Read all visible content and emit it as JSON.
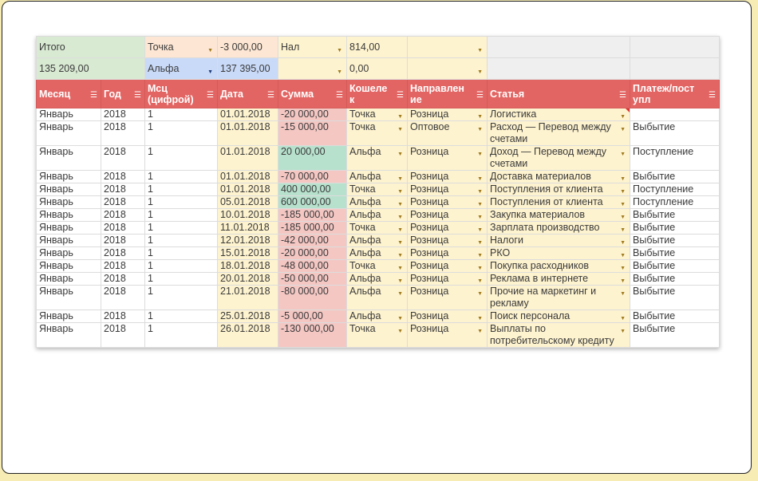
{
  "summary": {
    "row1": {
      "label": "Итого",
      "wallet": "Точка",
      "wallet_total": "-3 000,00",
      "cash": "Нал",
      "cash_total": "814,00"
    },
    "row2": {
      "total": "135 209,00",
      "wallet": "Альфа",
      "wallet_total": "137 395,00",
      "cash": "",
      "cash_total": "0,00"
    }
  },
  "columns": [
    "Месяц",
    "Год",
    "Мсц (цифрой)",
    "Дата",
    "Сумма",
    "Кошелек",
    "Направление",
    "Статья",
    "Платеж/поступл"
  ],
  "columns_wrapped": [
    "Месяц",
    "Год",
    "Мсц\n(цифрой)",
    "Дата",
    "Сумма",
    "Кошеле\nк",
    "Направлен\nие",
    "Статья",
    "Платеж/пост\nупл"
  ],
  "rows": [
    {
      "month": "Январь",
      "year": "2018",
      "mnum": "1",
      "date": "01.01.2018",
      "sum": "-20 000,00",
      "wallet": "Точка",
      "direction": "Розница",
      "article": "Логистика",
      "type": ""
    },
    {
      "month": "Январь",
      "year": "2018",
      "mnum": "1",
      "date": "01.01.2018",
      "sum": "-15 000,00",
      "wallet": "Точка",
      "direction": "Оптовое",
      "article": "Расход — Перевод между счетами",
      "type": "Выбытие"
    },
    {
      "month": "Январь",
      "year": "2018",
      "mnum": "1",
      "date": "01.01.2018",
      "sum": "20 000,00",
      "wallet": "Альфа",
      "direction": "Розница",
      "article": "Доход — Перевод между счетами",
      "type": "Поступление"
    },
    {
      "month": "Январь",
      "year": "2018",
      "mnum": "1",
      "date": "01.01.2018",
      "sum": "-70 000,00",
      "wallet": "Альфа",
      "direction": "Розница",
      "article": "Доставка материалов",
      "type": "Выбытие"
    },
    {
      "month": "Январь",
      "year": "2018",
      "mnum": "1",
      "date": "01.01.2018",
      "sum": "400 000,00",
      "wallet": "Точка",
      "direction": "Розница",
      "article": "Поступления от клиента",
      "type": "Поступление"
    },
    {
      "month": "Январь",
      "year": "2018",
      "mnum": "1",
      "date": "05.01.2018",
      "sum": "600 000,00",
      "wallet": "Альфа",
      "direction": "Розница",
      "article": "Поступления от клиента",
      "type": "Поступление"
    },
    {
      "month": "Январь",
      "year": "2018",
      "mnum": "1",
      "date": "10.01.2018",
      "sum": "-185 000,00",
      "wallet": "Альфа",
      "direction": "Розница",
      "article": "Закупка материалов",
      "type": "Выбытие"
    },
    {
      "month": "Январь",
      "year": "2018",
      "mnum": "1",
      "date": "11.01.2018",
      "sum": "-185 000,00",
      "wallet": "Точка",
      "direction": "Розница",
      "article": "Зарплата производство",
      "type": "Выбытие"
    },
    {
      "month": "Январь",
      "year": "2018",
      "mnum": "1",
      "date": "12.01.2018",
      "sum": "-42 000,00",
      "wallet": "Альфа",
      "direction": "Розница",
      "article": "Налоги",
      "type": "Выбытие"
    },
    {
      "month": "Январь",
      "year": "2018",
      "mnum": "1",
      "date": "15.01.2018",
      "sum": "-20 000,00",
      "wallet": "Альфа",
      "direction": "Розница",
      "article": "РКО",
      "type": "Выбытие"
    },
    {
      "month": "Январь",
      "year": "2018",
      "mnum": "1",
      "date": "18.01.2018",
      "sum": "-48 000,00",
      "wallet": "Точка",
      "direction": "Розница",
      "article": "Покупка расходников",
      "type": "Выбытие"
    },
    {
      "month": "Январь",
      "year": "2018",
      "mnum": "1",
      "date": "20.01.2018",
      "sum": "-50 000,00",
      "wallet": "Альфа",
      "direction": "Розница",
      "article": "Реклама в интернете",
      "type": "Выбытие"
    },
    {
      "month": "Январь",
      "year": "2018",
      "mnum": "1",
      "date": "21.01.2018",
      "sum": "-80 000,00",
      "wallet": "Альфа",
      "direction": "Розница",
      "article": "Прочие на маркетинг и рекламу",
      "type": "Выбытие"
    },
    {
      "month": "Январь",
      "year": "2018",
      "mnum": "1",
      "date": "25.01.2018",
      "sum": "-5 000,00",
      "wallet": "Альфа",
      "direction": "Розница",
      "article": "Поиск персонала",
      "type": "Выбытие"
    },
    {
      "month": "Январь",
      "year": "2018",
      "mnum": "1",
      "date": "26.01.2018",
      "sum": "-130 000,00",
      "wallet": "Точка",
      "direction": "Розница",
      "article": "Выплаты по потребительскому кредиту",
      "type": "Выбытие"
    }
  ],
  "colors": {
    "header": "#e26563",
    "income": "#b7e1cd",
    "expense": "#f4c7c3",
    "highlight": "#fef3cf"
  },
  "icons": {
    "dropdown": "dropdown-arrow-icon",
    "filter": "filter-icon",
    "comment": "comment-marker-icon"
  }
}
